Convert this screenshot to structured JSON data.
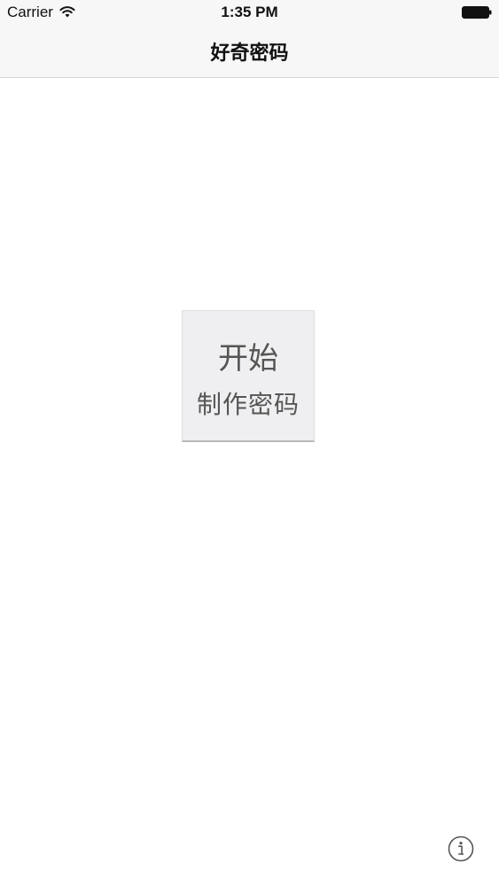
{
  "status_bar": {
    "carrier": "Carrier",
    "time": "1:35 PM",
    "wifi_icon": "wifi-icon",
    "battery_icon": "battery-full-icon"
  },
  "nav": {
    "title": "好奇密码"
  },
  "main": {
    "start_button": {
      "line1": "开始",
      "line2": "制作密码"
    },
    "info_icon": "info-icon"
  },
  "colors": {
    "nav_background": "#f7f7f8",
    "button_background": "#efeef0",
    "button_text": "#555555",
    "background": "#ffffff"
  }
}
